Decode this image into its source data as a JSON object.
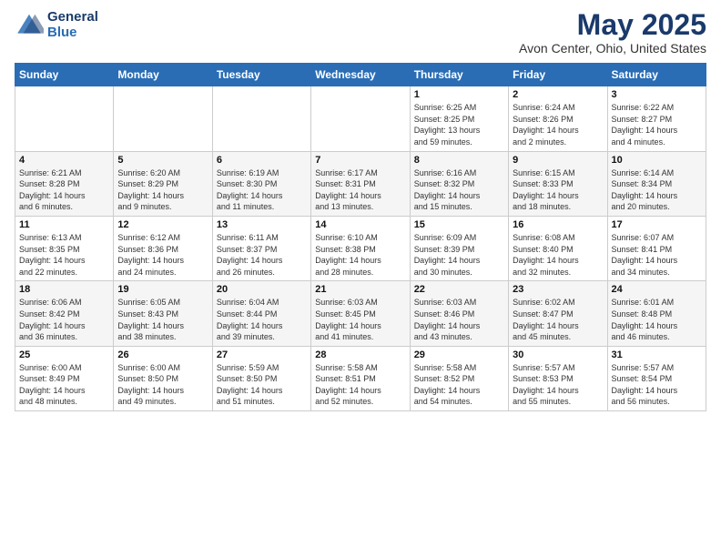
{
  "header": {
    "logo_line1": "General",
    "logo_line2": "Blue",
    "month": "May 2025",
    "location": "Avon Center, Ohio, United States"
  },
  "weekdays": [
    "Sunday",
    "Monday",
    "Tuesday",
    "Wednesday",
    "Thursday",
    "Friday",
    "Saturday"
  ],
  "weeks": [
    [
      {
        "day": "",
        "info": ""
      },
      {
        "day": "",
        "info": ""
      },
      {
        "day": "",
        "info": ""
      },
      {
        "day": "",
        "info": ""
      },
      {
        "day": "1",
        "info": "Sunrise: 6:25 AM\nSunset: 8:25 PM\nDaylight: 13 hours\nand 59 minutes."
      },
      {
        "day": "2",
        "info": "Sunrise: 6:24 AM\nSunset: 8:26 PM\nDaylight: 14 hours\nand 2 minutes."
      },
      {
        "day": "3",
        "info": "Sunrise: 6:22 AM\nSunset: 8:27 PM\nDaylight: 14 hours\nand 4 minutes."
      }
    ],
    [
      {
        "day": "4",
        "info": "Sunrise: 6:21 AM\nSunset: 8:28 PM\nDaylight: 14 hours\nand 6 minutes."
      },
      {
        "day": "5",
        "info": "Sunrise: 6:20 AM\nSunset: 8:29 PM\nDaylight: 14 hours\nand 9 minutes."
      },
      {
        "day": "6",
        "info": "Sunrise: 6:19 AM\nSunset: 8:30 PM\nDaylight: 14 hours\nand 11 minutes."
      },
      {
        "day": "7",
        "info": "Sunrise: 6:17 AM\nSunset: 8:31 PM\nDaylight: 14 hours\nand 13 minutes."
      },
      {
        "day": "8",
        "info": "Sunrise: 6:16 AM\nSunset: 8:32 PM\nDaylight: 14 hours\nand 15 minutes."
      },
      {
        "day": "9",
        "info": "Sunrise: 6:15 AM\nSunset: 8:33 PM\nDaylight: 14 hours\nand 18 minutes."
      },
      {
        "day": "10",
        "info": "Sunrise: 6:14 AM\nSunset: 8:34 PM\nDaylight: 14 hours\nand 20 minutes."
      }
    ],
    [
      {
        "day": "11",
        "info": "Sunrise: 6:13 AM\nSunset: 8:35 PM\nDaylight: 14 hours\nand 22 minutes."
      },
      {
        "day": "12",
        "info": "Sunrise: 6:12 AM\nSunset: 8:36 PM\nDaylight: 14 hours\nand 24 minutes."
      },
      {
        "day": "13",
        "info": "Sunrise: 6:11 AM\nSunset: 8:37 PM\nDaylight: 14 hours\nand 26 minutes."
      },
      {
        "day": "14",
        "info": "Sunrise: 6:10 AM\nSunset: 8:38 PM\nDaylight: 14 hours\nand 28 minutes."
      },
      {
        "day": "15",
        "info": "Sunrise: 6:09 AM\nSunset: 8:39 PM\nDaylight: 14 hours\nand 30 minutes."
      },
      {
        "day": "16",
        "info": "Sunrise: 6:08 AM\nSunset: 8:40 PM\nDaylight: 14 hours\nand 32 minutes."
      },
      {
        "day": "17",
        "info": "Sunrise: 6:07 AM\nSunset: 8:41 PM\nDaylight: 14 hours\nand 34 minutes."
      }
    ],
    [
      {
        "day": "18",
        "info": "Sunrise: 6:06 AM\nSunset: 8:42 PM\nDaylight: 14 hours\nand 36 minutes."
      },
      {
        "day": "19",
        "info": "Sunrise: 6:05 AM\nSunset: 8:43 PM\nDaylight: 14 hours\nand 38 minutes."
      },
      {
        "day": "20",
        "info": "Sunrise: 6:04 AM\nSunset: 8:44 PM\nDaylight: 14 hours\nand 39 minutes."
      },
      {
        "day": "21",
        "info": "Sunrise: 6:03 AM\nSunset: 8:45 PM\nDaylight: 14 hours\nand 41 minutes."
      },
      {
        "day": "22",
        "info": "Sunrise: 6:03 AM\nSunset: 8:46 PM\nDaylight: 14 hours\nand 43 minutes."
      },
      {
        "day": "23",
        "info": "Sunrise: 6:02 AM\nSunset: 8:47 PM\nDaylight: 14 hours\nand 45 minutes."
      },
      {
        "day": "24",
        "info": "Sunrise: 6:01 AM\nSunset: 8:48 PM\nDaylight: 14 hours\nand 46 minutes."
      }
    ],
    [
      {
        "day": "25",
        "info": "Sunrise: 6:00 AM\nSunset: 8:49 PM\nDaylight: 14 hours\nand 48 minutes."
      },
      {
        "day": "26",
        "info": "Sunrise: 6:00 AM\nSunset: 8:50 PM\nDaylight: 14 hours\nand 49 minutes."
      },
      {
        "day": "27",
        "info": "Sunrise: 5:59 AM\nSunset: 8:50 PM\nDaylight: 14 hours\nand 51 minutes."
      },
      {
        "day": "28",
        "info": "Sunrise: 5:58 AM\nSunset: 8:51 PM\nDaylight: 14 hours\nand 52 minutes."
      },
      {
        "day": "29",
        "info": "Sunrise: 5:58 AM\nSunset: 8:52 PM\nDaylight: 14 hours\nand 54 minutes."
      },
      {
        "day": "30",
        "info": "Sunrise: 5:57 AM\nSunset: 8:53 PM\nDaylight: 14 hours\nand 55 minutes."
      },
      {
        "day": "31",
        "info": "Sunrise: 5:57 AM\nSunset: 8:54 PM\nDaylight: 14 hours\nand 56 minutes."
      }
    ]
  ]
}
